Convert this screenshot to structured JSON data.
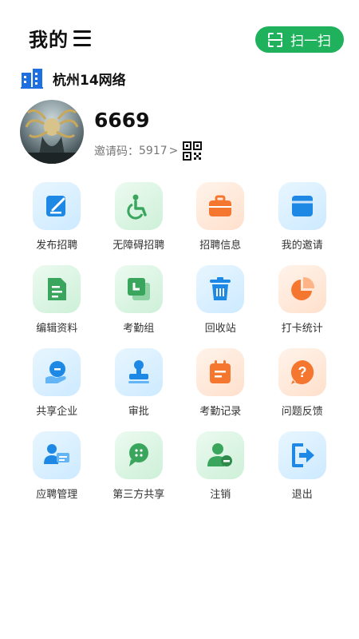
{
  "header": {
    "title": "我的",
    "scan_label": "扫一扫"
  },
  "org": {
    "name": "杭州14网络"
  },
  "user": {
    "name": "6669",
    "invite_label": "邀请码：",
    "invite_code": "5917"
  },
  "menu": [
    {
      "label": "发布招聘",
      "icon": "post-job-icon"
    },
    {
      "label": "无障碍招聘",
      "icon": "accessibility-icon"
    },
    {
      "label": "招聘信息",
      "icon": "briefcase-icon"
    },
    {
      "label": "我的邀请",
      "icon": "invite-inbox-icon"
    },
    {
      "label": "编辑资料",
      "icon": "edit-document-icon"
    },
    {
      "label": "考勤组",
      "icon": "attendance-group-icon"
    },
    {
      "label": "回收站",
      "icon": "trash-icon"
    },
    {
      "label": "打卡统计",
      "icon": "pie-chart-icon"
    },
    {
      "label": "共享企业",
      "icon": "shared-company-icon"
    },
    {
      "label": "审批",
      "icon": "stamp-icon"
    },
    {
      "label": "考勤记录",
      "icon": "calendar-icon"
    },
    {
      "label": "问题反馈",
      "icon": "question-icon"
    },
    {
      "label": "应聘管理",
      "icon": "applicant-icon"
    },
    {
      "label": "第三方共享",
      "icon": "third-party-share-icon"
    },
    {
      "label": "注销",
      "icon": "user-remove-icon"
    },
    {
      "label": "退出",
      "icon": "logout-icon"
    }
  ],
  "colors": {
    "accent": "#1fb15c",
    "blue": "#1e88e5",
    "green": "#3aa55c",
    "orange": "#f5772f"
  }
}
